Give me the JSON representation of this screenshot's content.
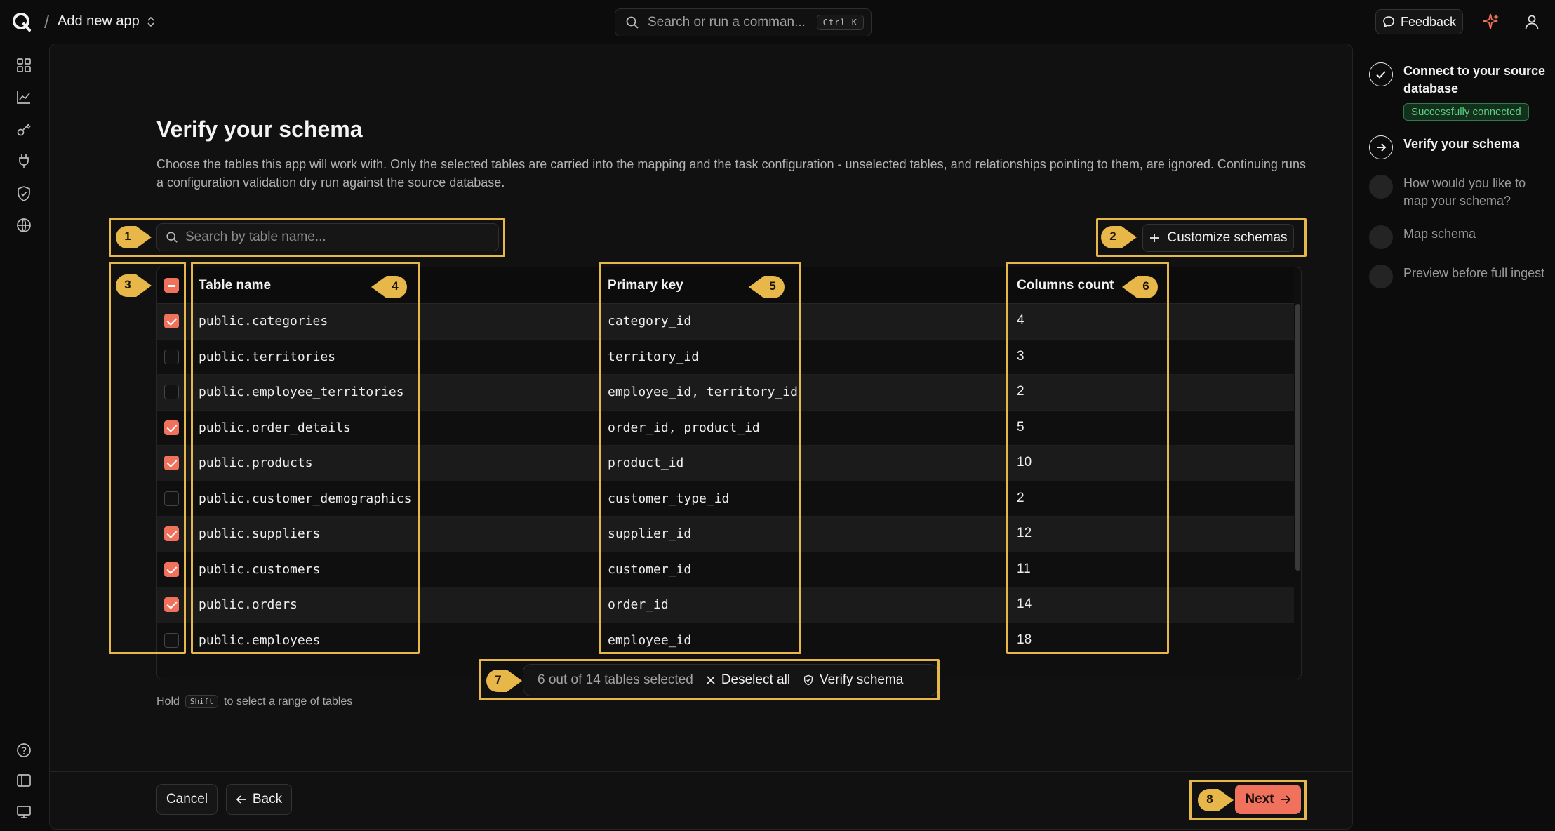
{
  "topbar": {
    "app_title": "Add new app",
    "separator": "/",
    "command_placeholder": "Search or run a comman...",
    "command_shortcut": "Ctrl K",
    "feedback_label": "Feedback"
  },
  "page": {
    "title": "Verify your schema",
    "description": "Choose the tables this app will work with. Only the selected tables are carried into the mapping and the task configuration - unselected tables, and relationships pointing to them, are ignored. Continuing runs a configuration validation dry run against the source database.",
    "search_placeholder": "Search by table name...",
    "customize_label": "Customize schemas"
  },
  "table": {
    "headers": {
      "name": "Table name",
      "pk": "Primary key",
      "cols": "Columns count"
    },
    "rows": [
      {
        "name": "public.categories",
        "pk": "category_id",
        "cols": "4",
        "checked": true
      },
      {
        "name": "public.territories",
        "pk": "territory_id",
        "cols": "3",
        "checked": false
      },
      {
        "name": "public.employee_territories",
        "pk": "employee_id, territory_id",
        "cols": "2",
        "checked": false
      },
      {
        "name": "public.order_details",
        "pk": "order_id, product_id",
        "cols": "5",
        "checked": true
      },
      {
        "name": "public.products",
        "pk": "product_id",
        "cols": "10",
        "checked": true
      },
      {
        "name": "public.customer_demographics",
        "pk": "customer_type_id",
        "cols": "2",
        "checked": false
      },
      {
        "name": "public.suppliers",
        "pk": "supplier_id",
        "cols": "12",
        "checked": true
      },
      {
        "name": "public.customers",
        "pk": "customer_id",
        "cols": "11",
        "checked": true
      },
      {
        "name": "public.orders",
        "pk": "order_id",
        "cols": "14",
        "checked": true
      },
      {
        "name": "public.employees",
        "pk": "employee_id",
        "cols": "18",
        "checked": false
      }
    ]
  },
  "selection": {
    "count_text": "6 out of 14 tables selected",
    "deselect_label": "Deselect all",
    "verify_label": "Verify schema"
  },
  "hint": {
    "before": "Hold",
    "key": "Shift",
    "after": "to select a range of tables"
  },
  "footer": {
    "cancel": "Cancel",
    "back": "Back",
    "next": "Next"
  },
  "steps": [
    {
      "label": "Connect to your source database",
      "state": "done",
      "badge": "Successfully connected"
    },
    {
      "label": "Verify your schema",
      "state": "current"
    },
    {
      "label": "How would you like to map your schema?",
      "state": "todo"
    },
    {
      "label": "Map schema",
      "state": "todo"
    },
    {
      "label": "Preview before full ingest",
      "state": "todo"
    }
  ],
  "annotations": [
    "1",
    "2",
    "3",
    "4",
    "5",
    "6",
    "7",
    "8"
  ],
  "colors": {
    "accent": "#f0725c",
    "annotation": "#e8b74a",
    "success": "#5ad07f"
  }
}
